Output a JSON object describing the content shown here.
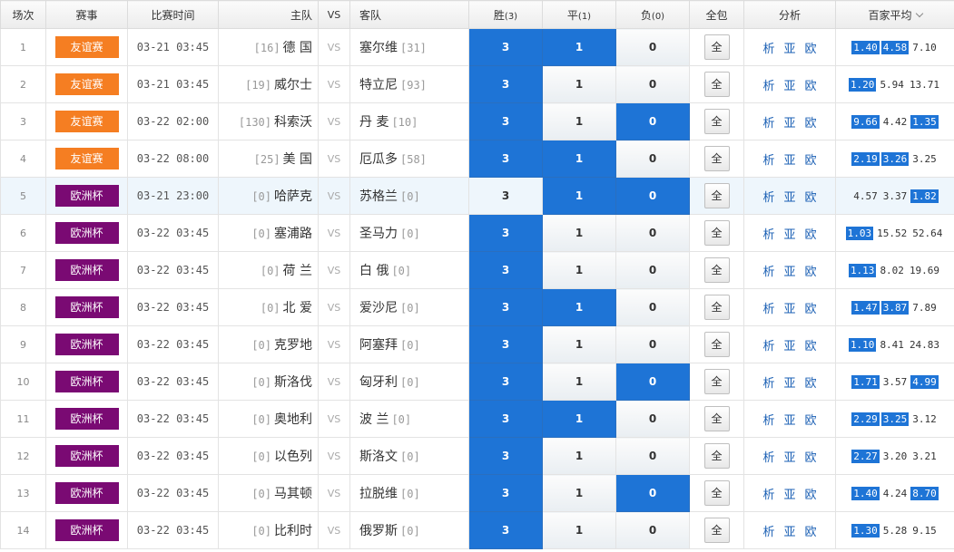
{
  "header": {
    "round": "场次",
    "league": "赛事",
    "time": "比赛时间",
    "home": "主队",
    "vs": "VS",
    "away": "客队",
    "win": "胜",
    "win_code": "(3)",
    "draw": "平",
    "draw_code": "(1)",
    "lose": "负",
    "lose_code": "(0)",
    "all": "全包",
    "analysis": "分析",
    "odds_avg": "百家平均"
  },
  "colors": {
    "friendly": "#f57e22",
    "euro": "#7a0a73",
    "selected": "#1e74d6",
    "row_highlight": "#eef6fc"
  },
  "all_label": "全",
  "analysis_links": [
    "析",
    "亚",
    "欧"
  ],
  "rows": [
    {
      "idx": "1",
      "league": "友谊赛",
      "league_type": "friendly",
      "time": "03-21 03:45",
      "home_rank": "[16]",
      "home": "德 国",
      "vs": "VS",
      "away": "塞尔维",
      "away_rank": "[31]",
      "win": "3",
      "draw": "1",
      "lose": "0",
      "sel": [
        true,
        true,
        false
      ],
      "odds": [
        "1.40",
        "4.58",
        "7.10"
      ],
      "odds_hl": [
        true,
        true,
        false
      ],
      "highlight": false
    },
    {
      "idx": "2",
      "league": "友谊赛",
      "league_type": "friendly",
      "time": "03-21 03:45",
      "home_rank": "[19]",
      "home": "威尔士",
      "vs": "VS",
      "away": "特立尼",
      "away_rank": "[93]",
      "win": "3",
      "draw": "1",
      "lose": "0",
      "sel": [
        true,
        false,
        false
      ],
      "odds": [
        "1.20",
        "5.94",
        "13.71"
      ],
      "odds_hl": [
        true,
        false,
        false
      ],
      "highlight": false
    },
    {
      "idx": "3",
      "league": "友谊赛",
      "league_type": "friendly",
      "time": "03-22 02:00",
      "home_rank": "[130]",
      "home": "科索沃",
      "vs": "VS",
      "away": "丹 麦",
      "away_rank": "[10]",
      "win": "3",
      "draw": "1",
      "lose": "0",
      "sel": [
        true,
        false,
        true
      ],
      "odds": [
        "9.66",
        "4.42",
        "1.35"
      ],
      "odds_hl": [
        true,
        false,
        true
      ],
      "highlight": false
    },
    {
      "idx": "4",
      "league": "友谊赛",
      "league_type": "friendly",
      "time": "03-22 08:00",
      "home_rank": "[25]",
      "home": "美 国",
      "vs": "VS",
      "away": "厄瓜多",
      "away_rank": "[58]",
      "win": "3",
      "draw": "1",
      "lose": "0",
      "sel": [
        true,
        true,
        false
      ],
      "odds": [
        "2.19",
        "3.26",
        "3.25"
      ],
      "odds_hl": [
        true,
        true,
        false
      ],
      "highlight": false
    },
    {
      "idx": "5",
      "league": "欧洲杯",
      "league_type": "euro",
      "time": "03-21 23:00",
      "home_rank": "[0]",
      "home": "哈萨克",
      "vs": "VS",
      "away": "苏格兰",
      "away_rank": "[0]",
      "win": "3",
      "draw": "1",
      "lose": "0",
      "sel": [
        false,
        true,
        true
      ],
      "odds": [
        "4.57",
        "3.37",
        "1.82"
      ],
      "odds_hl": [
        false,
        false,
        true
      ],
      "highlight": true
    },
    {
      "idx": "6",
      "league": "欧洲杯",
      "league_type": "euro",
      "time": "03-22 03:45",
      "home_rank": "[0]",
      "home": "塞浦路",
      "vs": "VS",
      "away": "圣马力",
      "away_rank": "[0]",
      "win": "3",
      "draw": "1",
      "lose": "0",
      "sel": [
        true,
        false,
        false
      ],
      "odds": [
        "1.03",
        "15.52",
        "52.64"
      ],
      "odds_hl": [
        true,
        false,
        false
      ],
      "highlight": false
    },
    {
      "idx": "7",
      "league": "欧洲杯",
      "league_type": "euro",
      "time": "03-22 03:45",
      "home_rank": "[0]",
      "home": "荷 兰",
      "vs": "VS",
      "away": "白 俄",
      "away_rank": "[0]",
      "win": "3",
      "draw": "1",
      "lose": "0",
      "sel": [
        true,
        false,
        false
      ],
      "odds": [
        "1.13",
        "8.02",
        "19.69"
      ],
      "odds_hl": [
        true,
        false,
        false
      ],
      "highlight": false
    },
    {
      "idx": "8",
      "league": "欧洲杯",
      "league_type": "euro",
      "time": "03-22 03:45",
      "home_rank": "[0]",
      "home": "北 爱",
      "vs": "VS",
      "away": "爱沙尼",
      "away_rank": "[0]",
      "win": "3",
      "draw": "1",
      "lose": "0",
      "sel": [
        true,
        true,
        false
      ],
      "odds": [
        "1.47",
        "3.87",
        "7.89"
      ],
      "odds_hl": [
        true,
        true,
        false
      ],
      "highlight": false
    },
    {
      "idx": "9",
      "league": "欧洲杯",
      "league_type": "euro",
      "time": "03-22 03:45",
      "home_rank": "[0]",
      "home": "克罗地",
      "vs": "VS",
      "away": "阿塞拜",
      "away_rank": "[0]",
      "win": "3",
      "draw": "1",
      "lose": "0",
      "sel": [
        true,
        false,
        false
      ],
      "odds": [
        "1.10",
        "8.41",
        "24.83"
      ],
      "odds_hl": [
        true,
        false,
        false
      ],
      "highlight": false
    },
    {
      "idx": "10",
      "league": "欧洲杯",
      "league_type": "euro",
      "time": "03-22 03:45",
      "home_rank": "[0]",
      "home": "斯洛伐",
      "vs": "VS",
      "away": "匈牙利",
      "away_rank": "[0]",
      "win": "3",
      "draw": "1",
      "lose": "0",
      "sel": [
        true,
        false,
        true
      ],
      "odds": [
        "1.71",
        "3.57",
        "4.99"
      ],
      "odds_hl": [
        true,
        false,
        true
      ],
      "highlight": false
    },
    {
      "idx": "11",
      "league": "欧洲杯",
      "league_type": "euro",
      "time": "03-22 03:45",
      "home_rank": "[0]",
      "home": "奥地利",
      "vs": "VS",
      "away": "波 兰",
      "away_rank": "[0]",
      "win": "3",
      "draw": "1",
      "lose": "0",
      "sel": [
        true,
        true,
        false
      ],
      "odds": [
        "2.29",
        "3.25",
        "3.12"
      ],
      "odds_hl": [
        true,
        true,
        false
      ],
      "highlight": false
    },
    {
      "idx": "12",
      "league": "欧洲杯",
      "league_type": "euro",
      "time": "03-22 03:45",
      "home_rank": "[0]",
      "home": "以色列",
      "vs": "VS",
      "away": "斯洛文",
      "away_rank": "[0]",
      "win": "3",
      "draw": "1",
      "lose": "0",
      "sel": [
        true,
        false,
        false
      ],
      "odds": [
        "2.27",
        "3.20",
        "3.21"
      ],
      "odds_hl": [
        true,
        false,
        false
      ],
      "highlight": false
    },
    {
      "idx": "13",
      "league": "欧洲杯",
      "league_type": "euro",
      "time": "03-22 03:45",
      "home_rank": "[0]",
      "home": "马其顿",
      "vs": "VS",
      "away": "拉脱维",
      "away_rank": "[0]",
      "win": "3",
      "draw": "1",
      "lose": "0",
      "sel": [
        true,
        false,
        true
      ],
      "odds": [
        "1.40",
        "4.24",
        "8.70"
      ],
      "odds_hl": [
        true,
        false,
        true
      ],
      "highlight": false
    },
    {
      "idx": "14",
      "league": "欧洲杯",
      "league_type": "euro",
      "time": "03-22 03:45",
      "home_rank": "[0]",
      "home": "比利时",
      "vs": "VS",
      "away": "俄罗斯",
      "away_rank": "[0]",
      "win": "3",
      "draw": "1",
      "lose": "0",
      "sel": [
        true,
        false,
        false
      ],
      "odds": [
        "1.30",
        "5.28",
        "9.15"
      ],
      "odds_hl": [
        true,
        false,
        false
      ],
      "highlight": false
    }
  ]
}
